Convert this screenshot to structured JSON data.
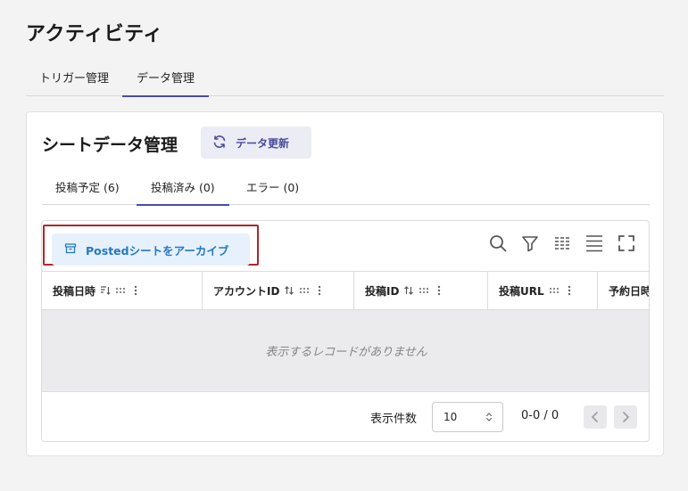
{
  "page": {
    "title": "アクティビティ"
  },
  "top_tabs": [
    {
      "label": "トリガー管理",
      "active": false
    },
    {
      "label": "データ管理",
      "active": true
    }
  ],
  "card": {
    "title": "シートデータ管理",
    "refresh_label": "データ更新",
    "sub_tabs": [
      {
        "label": "投稿予定 (6)",
        "active": false
      },
      {
        "label": "投稿済み (0)",
        "active": true
      },
      {
        "label": "エラー (0)",
        "active": false
      }
    ]
  },
  "grid": {
    "archive_label": "Postedシートをアーカイブ",
    "toolbar_icons": [
      "search-icon",
      "filter-icon",
      "columns-icon",
      "density-icon",
      "fullscreen-icon"
    ],
    "columns": [
      {
        "label": "投稿日時",
        "sort_icon": "sort-desc-icon",
        "has_drag": true,
        "has_menu": true
      },
      {
        "label": "アカウントID",
        "sort_icon": "sort-icon",
        "has_drag": true,
        "has_menu": true
      },
      {
        "label": "投稿ID",
        "sort_icon": "sort-icon",
        "has_drag": true,
        "has_menu": true
      },
      {
        "label": "投稿URL",
        "sort_icon": "",
        "has_drag": true,
        "has_menu": true
      },
      {
        "label": "予約日時",
        "sort_icon": "",
        "has_drag": false,
        "has_menu": false
      }
    ],
    "empty_message": "表示するレコードがありません",
    "pagination": {
      "rows_label": "表示件数",
      "rows_value": "10",
      "range": "0-0 / 0"
    }
  },
  "colors": {
    "accent": "#4b4ba8",
    "archive_text": "#2478c4",
    "archive_bg": "#e6f1fb",
    "highlight_border": "#b0262b"
  }
}
